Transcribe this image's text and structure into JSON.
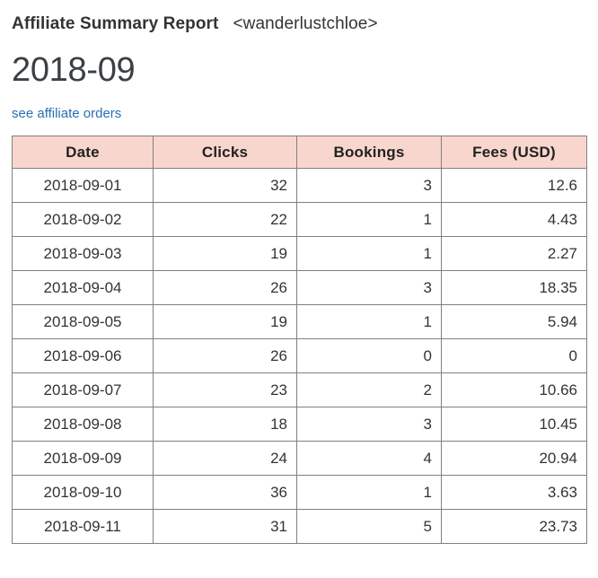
{
  "header": {
    "report_title": "Affiliate Summary Report",
    "account": "<wanderlustchloe>",
    "period": "2018-09",
    "orders_link_label": "see affiliate orders"
  },
  "colors": {
    "header_fill": "#f8d6ce",
    "border": "#808080",
    "link": "#2a6eb5",
    "text": "#333333",
    "background": "#ffffff"
  },
  "table": {
    "columns": [
      {
        "key": "date",
        "label": "Date",
        "align": "center"
      },
      {
        "key": "clicks",
        "label": "Clicks",
        "align": "right"
      },
      {
        "key": "bookings",
        "label": "Bookings",
        "align": "right"
      },
      {
        "key": "fees",
        "label": "Fees (USD)",
        "align": "right"
      }
    ],
    "rows": [
      {
        "date": "2018-09-01",
        "clicks": "32",
        "bookings": "3",
        "fees": "12.6"
      },
      {
        "date": "2018-09-02",
        "clicks": "22",
        "bookings": "1",
        "fees": "4.43"
      },
      {
        "date": "2018-09-03",
        "clicks": "19",
        "bookings": "1",
        "fees": "2.27"
      },
      {
        "date": "2018-09-04",
        "clicks": "26",
        "bookings": "3",
        "fees": "18.35"
      },
      {
        "date": "2018-09-05",
        "clicks": "19",
        "bookings": "1",
        "fees": "5.94"
      },
      {
        "date": "2018-09-06",
        "clicks": "26",
        "bookings": "0",
        "fees": "0"
      },
      {
        "date": "2018-09-07",
        "clicks": "23",
        "bookings": "2",
        "fees": "10.66"
      },
      {
        "date": "2018-09-08",
        "clicks": "18",
        "bookings": "3",
        "fees": "10.45"
      },
      {
        "date": "2018-09-09",
        "clicks": "24",
        "bookings": "4",
        "fees": "20.94"
      },
      {
        "date": "2018-09-10",
        "clicks": "36",
        "bookings": "1",
        "fees": "3.63"
      },
      {
        "date": "2018-09-11",
        "clicks": "31",
        "bookings": "5",
        "fees": "23.73"
      }
    ]
  }
}
